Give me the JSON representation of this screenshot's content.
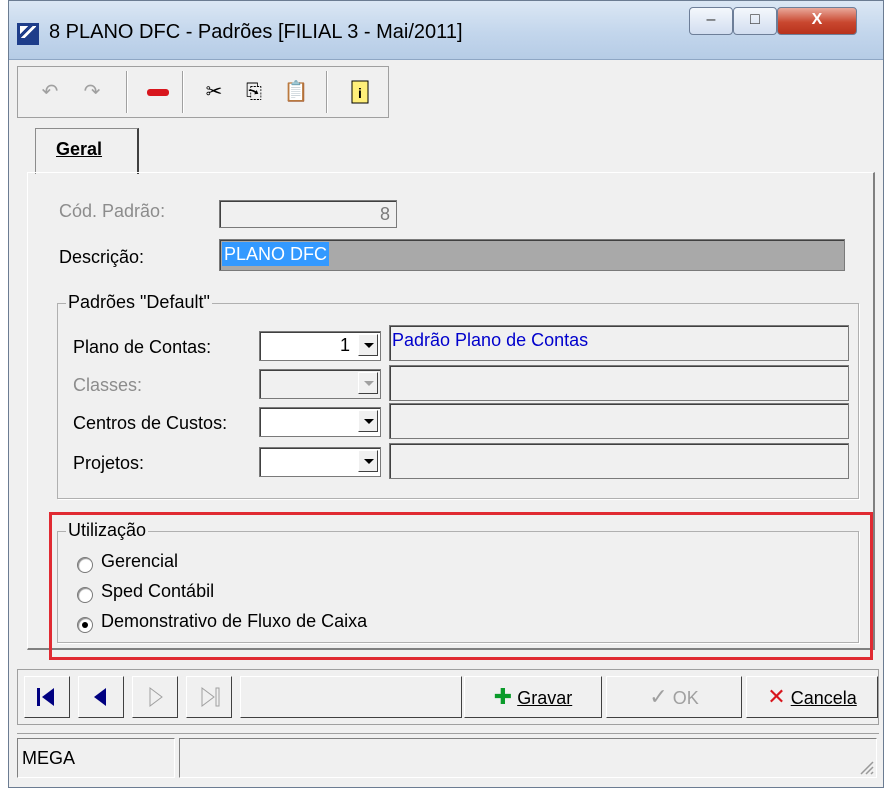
{
  "window": {
    "title": "8 PLANO DFC -  Padrões [FILIAL 3 - Mai/2011]",
    "minimize_glyph": "–",
    "maximize_glyph": "□",
    "close_glyph": "X"
  },
  "toolbar": {
    "icons": [
      "undo-icon",
      "redo-icon",
      "delete-icon",
      "cut-icon",
      "copy-icon",
      "paste-icon",
      "info-icon"
    ]
  },
  "tabs": [
    {
      "label": "Geral",
      "active": true
    }
  ],
  "form": {
    "cod_padrao_label": "Cód. Padrão:",
    "cod_padrao_value": "8",
    "descricao_label": "Descrição:",
    "descricao_value": "PLANO DFC"
  },
  "defaults_group": {
    "title": "Padrões \"Default\"",
    "plano_contas_label": "Plano de Contas:",
    "plano_contas_value": "1",
    "plano_contas_desc": "Padrão Plano de Contas",
    "classes_label": "Classes:",
    "centros_custos_label": "Centros de Custos:",
    "projetos_label": "Projetos:"
  },
  "utilizacao_group": {
    "title": "Utilização",
    "options": [
      {
        "label": "Gerencial",
        "selected": false
      },
      {
        "label": "Sped Contábil",
        "selected": false
      },
      {
        "label": "Demonstrativo de Fluxo de Caixa",
        "selected": true
      }
    ]
  },
  "nav": {
    "gravar_label": "Gravar",
    "ok_label": "OK",
    "cancela_label": "Cancela"
  },
  "status": {
    "text": "MEGA"
  },
  "colors": {
    "highlight": "#e02a32",
    "link_text": "#0000cc",
    "selection": "#3399ff"
  }
}
